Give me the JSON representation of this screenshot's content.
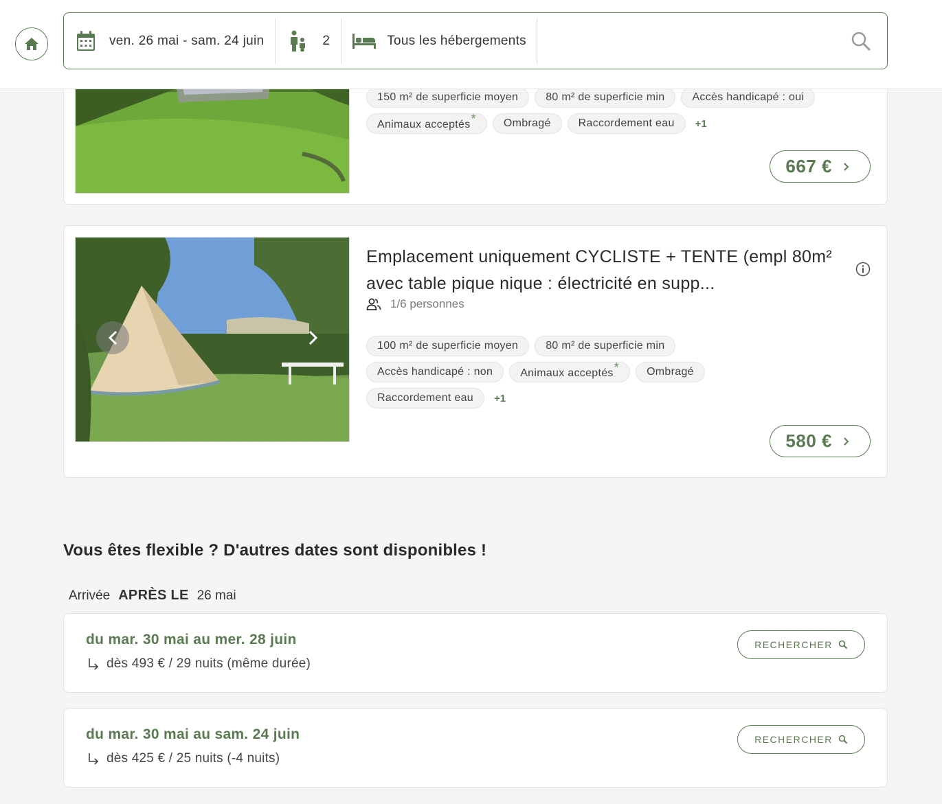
{
  "colors": {
    "accent": "#5a7a52",
    "tag_bg": "#f3f3f3",
    "page_bg": "#f5f5f5"
  },
  "header": {
    "home_icon": "home-icon",
    "dates": "ven. 26 mai - sam. 24 juin",
    "people": "2",
    "type": "Tous les hébergements"
  },
  "listings": [
    {
      "tags": [
        "150 m² de superficie moyen",
        "80 m² de superficie min",
        "Accès handicapé : oui",
        "Animaux acceptés",
        "Ombragé",
        "Raccordement eau"
      ],
      "more": "+1",
      "price": "667 €"
    },
    {
      "title": "Emplacement uniquement CYCLISTE + TENTE (empl 80m² avec table pique nique : électricité en supp...",
      "capacity": "1/6 personnes",
      "tags": [
        "100 m² de superficie moyen",
        "80 m² de superficie min",
        "Accès handicapé : non",
        "Animaux acceptés",
        "Ombragé",
        "Raccordement eau"
      ],
      "more": "+1",
      "price": "580 €"
    }
  ],
  "flexible": {
    "title": "Vous êtes flexible ? D'autres dates sont disponibles !",
    "arrival_label": "Arrivée",
    "arrival_bold": "APRÈS LE",
    "arrival_date": "26 mai",
    "options": [
      {
        "dates": "du mar. 30 mai au mer. 28 juin",
        "detail": "dès 493 € / 29 nuits (même durée)",
        "button": "RECHERCHER"
      },
      {
        "dates": "du mar. 30 mai au sam. 24 juin",
        "detail": "dès 425 € / 25 nuits (-4 nuits)",
        "button": "RECHERCHER"
      }
    ]
  }
}
